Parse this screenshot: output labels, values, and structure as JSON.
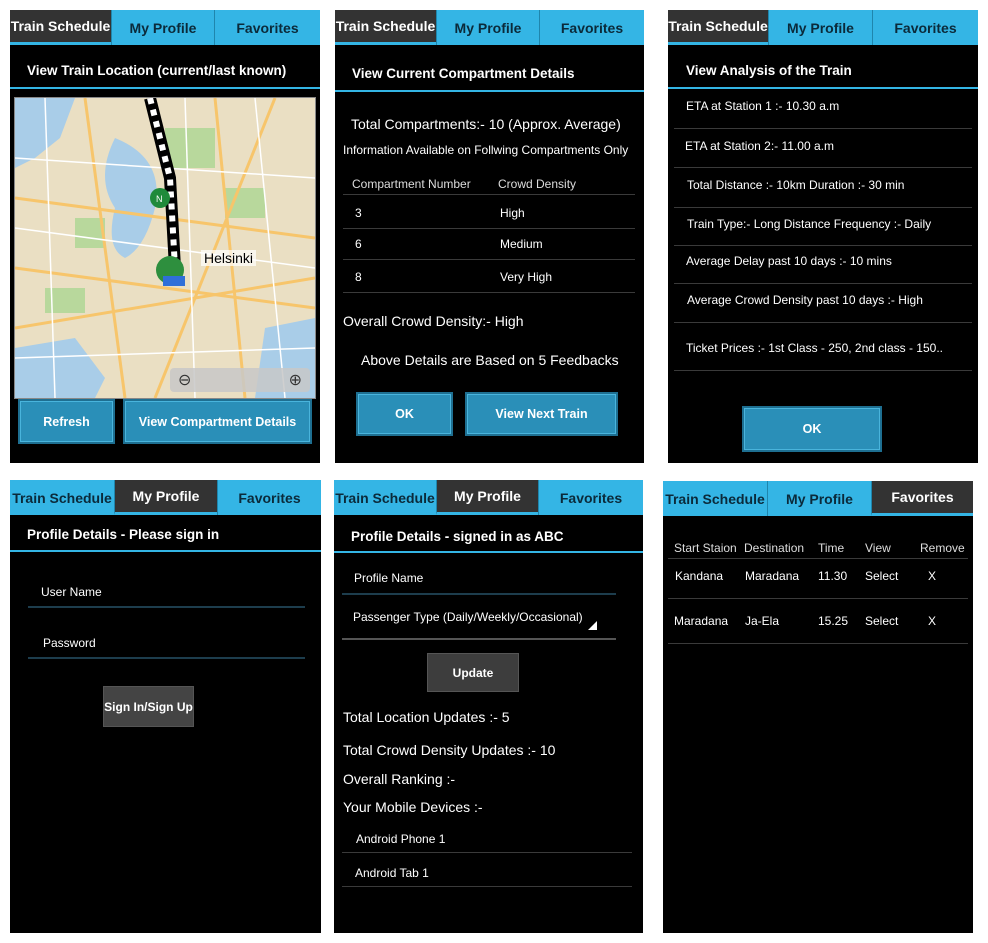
{
  "tabs": [
    "Train Schedule",
    "My Profile",
    "Favorites"
  ],
  "screen1": {
    "title": "View Train Location (current/last known)",
    "map_label": "Helsinki",
    "refresh": "Refresh",
    "view_compartment": "View Compartment Details"
  },
  "screen2": {
    "title": "View Current Compartment Details",
    "total": "Total Compartments:-  10 (Approx. Average)",
    "info": "Information Available on Follwing Compartments Only",
    "col_compartment": "Compartment Number",
    "col_density": "Crowd Density",
    "rows": [
      {
        "num": "3",
        "density": "High"
      },
      {
        "num": "6",
        "density": "Medium"
      },
      {
        "num": "8",
        "density": "Very High"
      }
    ],
    "overall": "Overall Crowd Density:-   High",
    "based": "Above Details are Based on 5 Feedbacks",
    "ok": "OK",
    "next": "View Next Train"
  },
  "screen3": {
    "title": "View Analysis of the Train",
    "items": [
      "ETA at Station 1 :- 10.30 a.m",
      "ETA at Station 2:- 11.00 a.m",
      "Total Distance :- 10km Duration :- 30 min",
      "Train Type:- Long Distance Frequency :- Daily",
      "Average Delay past 10 days :- 10 mins",
      "Average Crowd Density past 10 days :- High",
      "Ticket Prices :- 1st Class - 250, 2nd class - 150.."
    ],
    "ok": "OK"
  },
  "screen4": {
    "title": "Profile Details - Please sign in",
    "username": "User Name",
    "password": "Password",
    "signin": "Sign In/Sign Up"
  },
  "screen5": {
    "title": "Profile Details - signed in as ABC",
    "profile_name": "Profile Name",
    "passenger_type": "Passenger Type (Daily/Weekly/Occasional)",
    "update": "Update",
    "location_updates": "Total Location Updates :-  5",
    "crowd_updates": "Total Crowd Density Updates :-   10",
    "ranking": "Overall Ranking :-",
    "devices": "Your Mobile Devices :-",
    "device_list": [
      "Android Phone 1",
      "Android Tab 1"
    ]
  },
  "screen6": {
    "headers": [
      "Start Staion",
      "Destination",
      "Time",
      "View",
      "Remove"
    ],
    "rows": [
      [
        "Kandana",
        "Maradana",
        "11.30",
        "Select",
        "X"
      ],
      [
        "Maradana",
        "Ja-Ela",
        "15.25",
        "Select",
        "X"
      ]
    ]
  },
  "colors": {
    "accent": "#34b5e5",
    "button": "#2a8fb8",
    "background": "#000000"
  }
}
